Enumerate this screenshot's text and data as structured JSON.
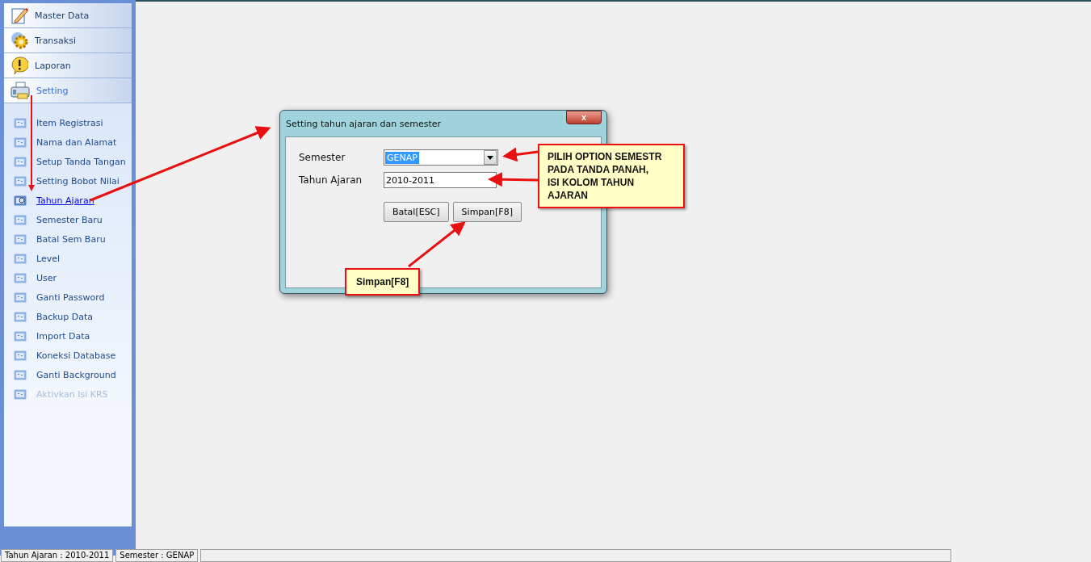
{
  "sidebar": {
    "sections": [
      {
        "label": "Master Data",
        "expanded": false
      },
      {
        "label": "Transaksi",
        "expanded": false
      },
      {
        "label": "Laporan",
        "expanded": false
      },
      {
        "label": "Setting",
        "expanded": true,
        "items": [
          {
            "label": "Item Registrasi",
            "selected": false,
            "disabled": false
          },
          {
            "label": "Nama dan Alamat",
            "selected": false,
            "disabled": false
          },
          {
            "label": "Setup Tanda Tangan",
            "selected": false,
            "disabled": false
          },
          {
            "label": "Setting Bobot Nilai",
            "selected": false,
            "disabled": false
          },
          {
            "label": "Tahun Ajaran",
            "selected": true,
            "disabled": false
          },
          {
            "label": "Semester Baru",
            "selected": false,
            "disabled": false
          },
          {
            "label": "Batal Sem Baru",
            "selected": false,
            "disabled": false
          },
          {
            "label": "Level",
            "selected": false,
            "disabled": false
          },
          {
            "label": "User",
            "selected": false,
            "disabled": false
          },
          {
            "label": "Ganti Password",
            "selected": false,
            "disabled": false
          },
          {
            "label": "Backup Data",
            "selected": false,
            "disabled": false
          },
          {
            "label": "Import Data",
            "selected": false,
            "disabled": false
          },
          {
            "label": "Koneksi Database",
            "selected": false,
            "disabled": false
          },
          {
            "label": "Ganti Background",
            "selected": false,
            "disabled": false
          },
          {
            "label": "Aktivkan Isi KRS",
            "selected": false,
            "disabled": true
          }
        ]
      }
    ]
  },
  "dialog": {
    "title": "Setting tahun ajaran dan semester",
    "close": "x",
    "fields": [
      {
        "kind": "dropdown",
        "label": "Semester",
        "value": "GENAP",
        "selected": true
      },
      {
        "kind": "text",
        "label": "Tahun Ajaran",
        "value": "2010-2011",
        "selected": false
      }
    ],
    "buttons": [
      "Batal[ESC]",
      "Simpan[F8]"
    ]
  },
  "callouts": [
    {
      "text": "PILIH OPTION SEMESTR\nPADA TANDA PANAH,\nISI KOLOM TAHUN\nAJARAN"
    },
    {
      "text": "Simpan[F8]"
    }
  ],
  "status_bar": [
    "Tahun Ajaran : 2010-2011",
    "Semester : GENAP"
  ]
}
